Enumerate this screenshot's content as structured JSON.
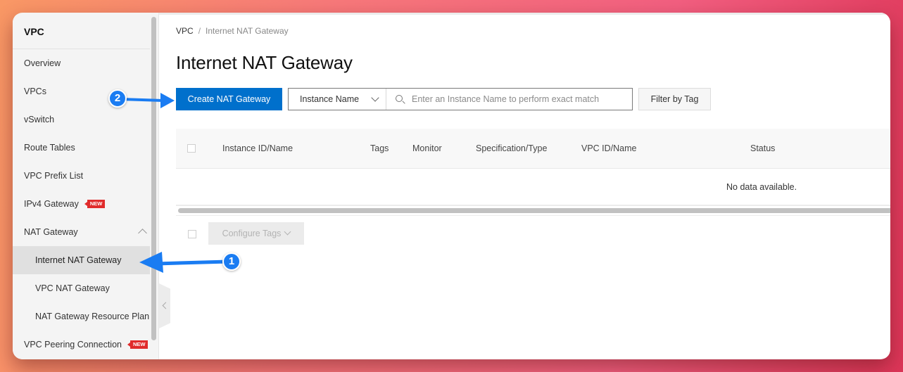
{
  "sidebar": {
    "title": "VPC",
    "items": [
      {
        "label": "Overview"
      },
      {
        "label": "VPCs"
      },
      {
        "label": "vSwitch"
      },
      {
        "label": "Route Tables"
      },
      {
        "label": "VPC Prefix List"
      },
      {
        "label": "IPv4 Gateway",
        "badge": "NEW"
      },
      {
        "label": "NAT Gateway",
        "expanded": true
      },
      {
        "label": "Internet NAT Gateway",
        "active": true
      },
      {
        "label": "VPC NAT Gateway"
      },
      {
        "label": "NAT Gateway Resource Plan"
      },
      {
        "label": "VPC Peering Connection",
        "badge": "NEW"
      }
    ]
  },
  "breadcrumb": {
    "root": "VPC",
    "separator": "/",
    "current": "Internet NAT Gateway"
  },
  "page": {
    "title": "Internet NAT Gateway"
  },
  "toolbar": {
    "create_label": "Create NAT Gateway",
    "select_value": "Instance Name",
    "search_placeholder": "Enter an Instance Name to perform exact match",
    "search_value": "",
    "filter_label": "Filter by Tag"
  },
  "table": {
    "columns": [
      "Instance ID/Name",
      "Tags",
      "Monitor",
      "Specification/Type",
      "VPC ID/Name",
      "Status"
    ],
    "rows": [],
    "empty_text": "No data available."
  },
  "footer": {
    "configure_tags_label": "Configure Tags"
  },
  "annotations": [
    {
      "number": "1",
      "target": "Internet NAT Gateway sidebar item"
    },
    {
      "number": "2",
      "target": "Create NAT Gateway button"
    }
  ],
  "colors": {
    "primary": "#0070cc",
    "annotation": "#1a7cf2",
    "badge": "#e02b2b",
    "accent": "#ff6a00"
  }
}
